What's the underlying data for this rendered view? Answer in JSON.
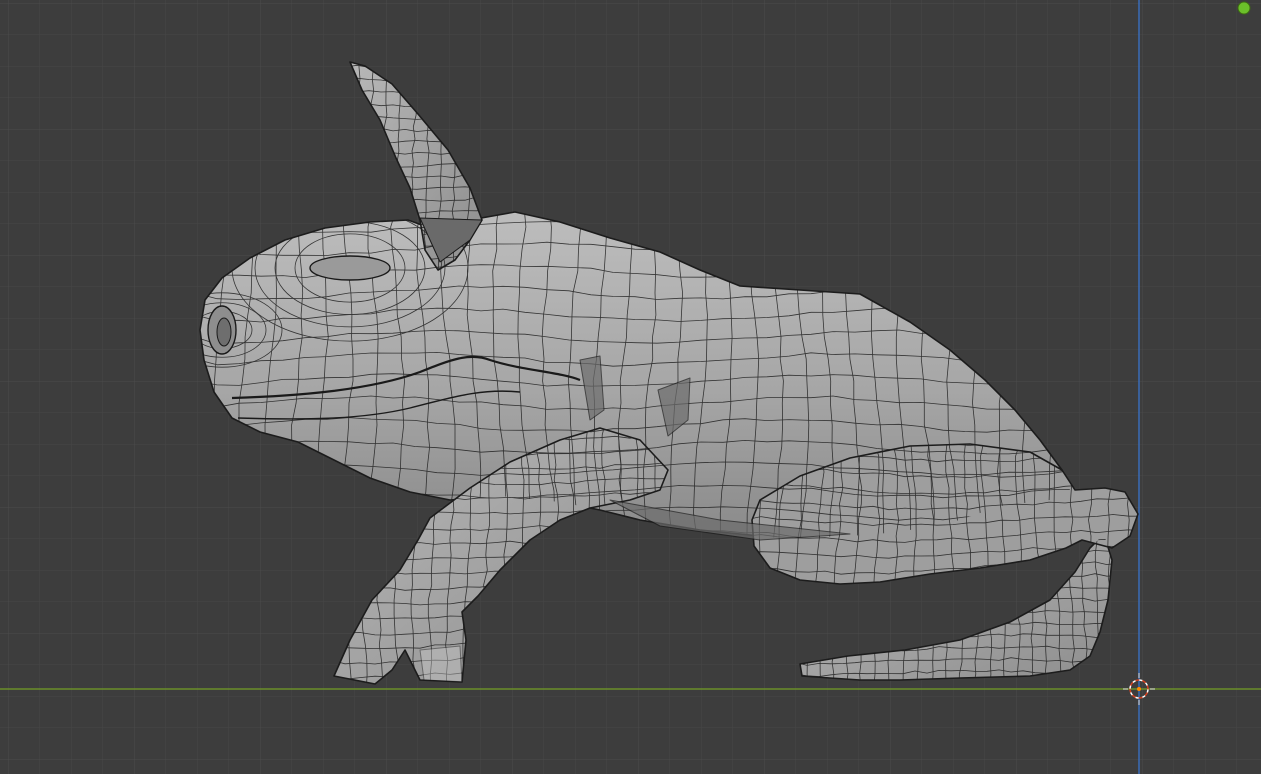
{
  "viewport": {
    "view": "orthographic-side",
    "background_color": "#3d3d3d",
    "grid_minor_color": "#454545",
    "grid_major_color": "#4d4d4d",
    "x_axis_color": "#6b8f2a",
    "z_axis_color": "#3a6cb8",
    "mesh_fill_color": "#a8a8a8",
    "mesh_wire_color": "#1e1e1e"
  },
  "scene": {
    "object": "frog-mesh",
    "display_mode": "solid-with-wireframe",
    "cursor": "3d-cursor-icon",
    "gizmo_dot_color": "#6bbf2a"
  }
}
